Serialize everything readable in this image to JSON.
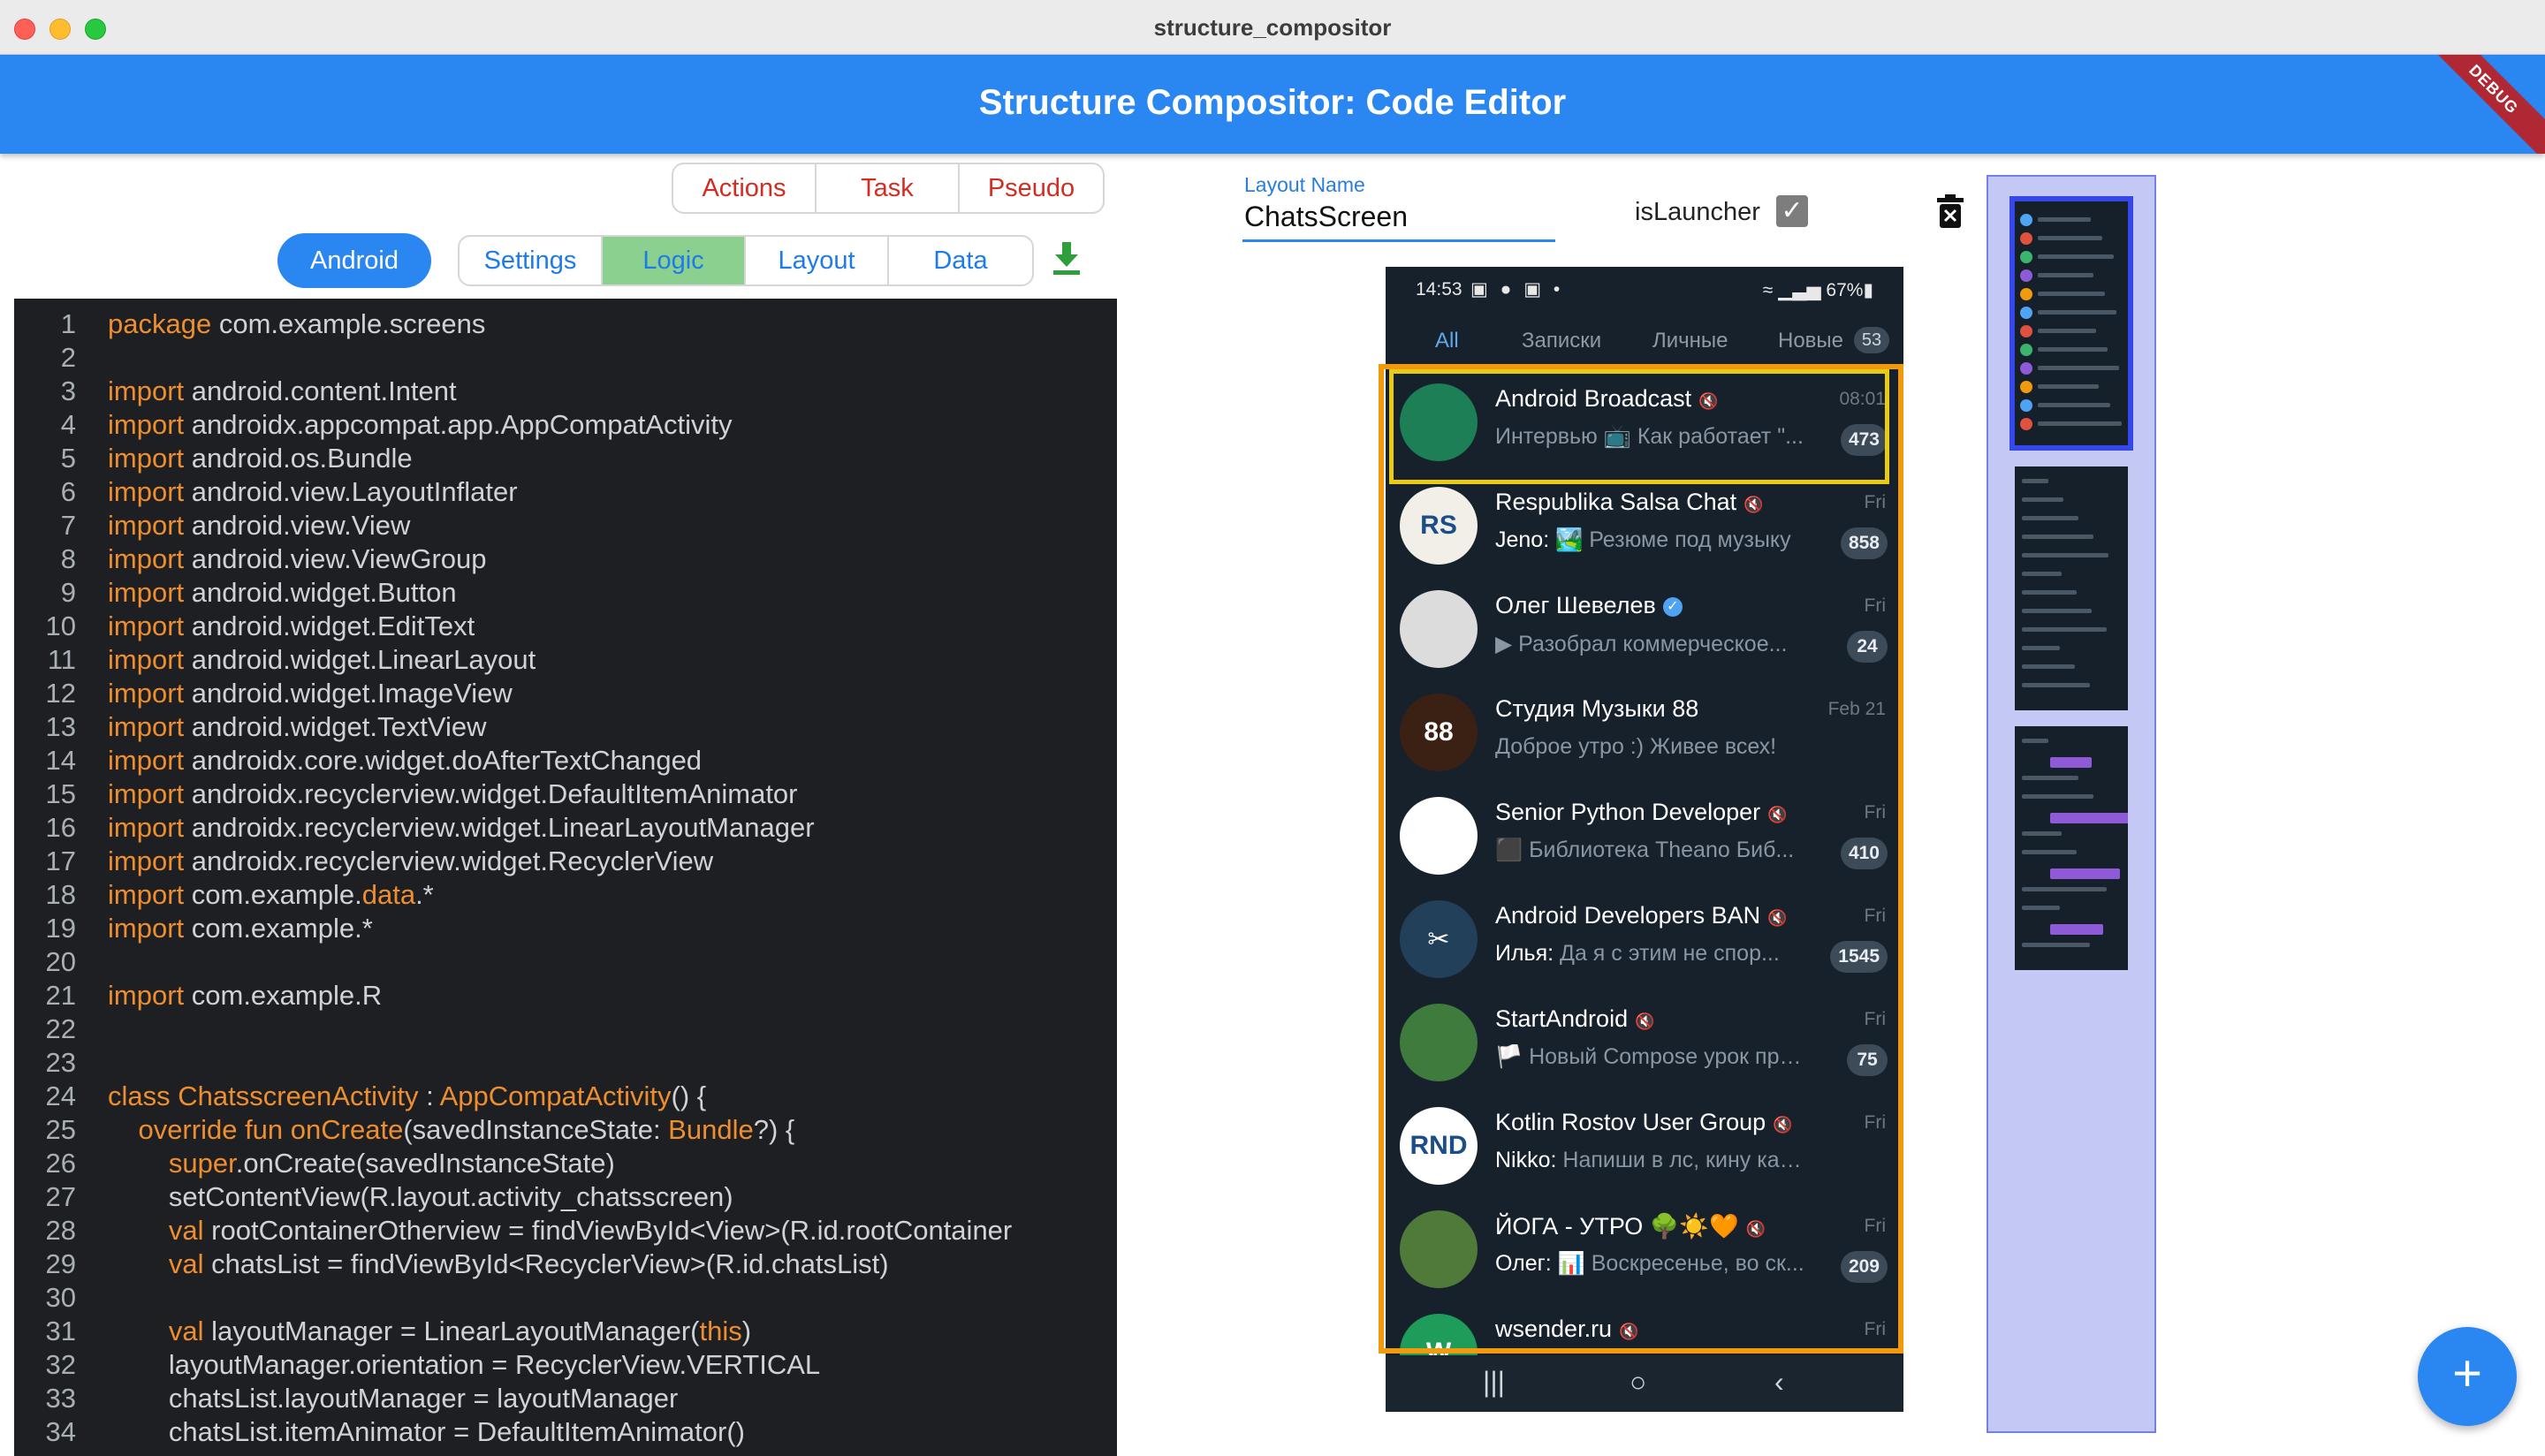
{
  "window": {
    "title": "structure_compositor"
  },
  "appbar": {
    "title": "Structure Compositor: Code Editor",
    "debug_label": "DEBUG"
  },
  "top_tabs": [
    "Actions",
    "Task",
    "Pseudo"
  ],
  "platform_button": "Android",
  "main_tabs": [
    {
      "label": "Settings",
      "active": false
    },
    {
      "label": "Logic",
      "active": true
    },
    {
      "label": "Layout",
      "active": false
    },
    {
      "label": "Data",
      "active": false
    }
  ],
  "code_lines": [
    {
      "n": "1",
      "kw": "package",
      "rest": " com.example.screens"
    },
    {
      "n": "2",
      "kw": "",
      "rest": ""
    },
    {
      "n": "3",
      "kw": "import",
      "rest": " android.content.Intent"
    },
    {
      "n": "4",
      "kw": "import",
      "rest": " androidx.appcompat.app.AppCompatActivity"
    },
    {
      "n": "5",
      "kw": "import",
      "rest": " android.os.Bundle"
    },
    {
      "n": "6",
      "kw": "import",
      "rest": " android.view.LayoutInflater"
    },
    {
      "n": "7",
      "kw": "import",
      "rest": " android.view.View"
    },
    {
      "n": "8",
      "kw": "import",
      "rest": " android.view.ViewGroup"
    },
    {
      "n": "9",
      "kw": "import",
      "rest": " android.widget.Button"
    },
    {
      "n": "10",
      "kw": "import",
      "rest": " android.widget.EditText"
    },
    {
      "n": "11",
      "kw": "import",
      "rest": " android.widget.LinearLayout"
    },
    {
      "n": "12",
      "kw": "import",
      "rest": " android.widget.ImageView"
    },
    {
      "n": "13",
      "kw": "import",
      "rest": " android.widget.TextView"
    },
    {
      "n": "14",
      "kw": "import",
      "rest": " androidx.core.widget.doAfterTextChanged"
    },
    {
      "n": "15",
      "kw": "import",
      "rest": " androidx.recyclerview.widget.DefaultItemAnimator"
    },
    {
      "n": "16",
      "kw": "import",
      "rest": " androidx.recyclerview.widget.LinearLayoutManager"
    },
    {
      "n": "17",
      "kw": "import",
      "rest": " androidx.recyclerview.widget.RecyclerView"
    },
    {
      "n": "18",
      "kw": "import",
      "rest": " com.example.",
      "kw2": "data",
      "rest2": ".*"
    },
    {
      "n": "19",
      "kw": "import",
      "rest": " com.example.*"
    },
    {
      "n": "20",
      "kw": "",
      "rest": ""
    },
    {
      "n": "21",
      "kw": "import",
      "rest": " com.example.R"
    },
    {
      "n": "22",
      "kw": "",
      "rest": ""
    },
    {
      "n": "23",
      "kw": "",
      "rest": ""
    },
    {
      "n": "24",
      "kw": "class",
      "rest": " ",
      "kw2": "ChatsscreenActivity",
      "rest2": " : ",
      "kw3": "AppCompatActivity",
      "rest3": "() {"
    },
    {
      "n": "25",
      "indent": "    ",
      "kw": "override fun",
      "rest": " ",
      "kw2": "onCreate",
      "rest2": "(savedInstanceState: ",
      "kw3": "Bundle",
      "rest3": "?) {"
    },
    {
      "n": "26",
      "indent": "        ",
      "kw": "super",
      "rest": ".onCreate(savedInstanceState)"
    },
    {
      "n": "27",
      "indent": "        ",
      "kw": "",
      "rest": "setContentView(R.layout.activity_chatsscreen)"
    },
    {
      "n": "28",
      "indent": "        ",
      "kw": "val",
      "rest": " rootContainerOtherview = findViewById<View>(R.id.rootContainer"
    },
    {
      "n": "29",
      "indent": "        ",
      "kw": "val",
      "rest": " chatsList = findViewById<RecyclerView>(R.id.chatsList)"
    },
    {
      "n": "30",
      "kw": "",
      "rest": ""
    },
    {
      "n": "31",
      "indent": "        ",
      "kw": "val",
      "rest": " layoutManager = LinearLayoutManager(",
      "kw2": "this",
      "rest2": ")"
    },
    {
      "n": "32",
      "indent": "        ",
      "kw": "",
      "rest": "layoutManager.orientation = RecyclerView.VERTICAL"
    },
    {
      "n": "33",
      "indent": "        ",
      "kw": "",
      "rest": "chatsList.layoutManager = layoutManager"
    },
    {
      "n": "34",
      "indent": "        ",
      "kw": "",
      "rest": "chatsList.itemAnimator = DefaultItemAnimator()"
    }
  ],
  "layout_form": {
    "label": "Layout Name",
    "value": "ChatsScreen",
    "launcher_label": "isLauncher",
    "launcher_checked": true
  },
  "phone": {
    "status_time": "14:53",
    "status_icons": "▣ ● ▣ •",
    "status_right": "≈ ▁▃▅ 67%▮",
    "tabs": [
      "All",
      "Записки",
      "Личные",
      "Новые"
    ],
    "tab_badge": "53",
    "chats": [
      {
        "name": "Android Broadcast",
        "time": "08:01",
        "sender": "",
        "message": "Интервью 📺 Как работает \"...",
        "badge": "473",
        "muted": true,
        "avatar_color": "#1c7f55",
        "avatar_text": ""
      },
      {
        "name": "Respublika Salsa Chat",
        "time": "Fri",
        "sender": "Jeno:",
        "message": " 🏞️ Резюме под музыку",
        "badge": "858",
        "muted": true,
        "avatar_color": "#f2efe9",
        "avatar_text": "RS"
      },
      {
        "name": "Олег Шевелев",
        "time": "Fri",
        "sender": "",
        "message": "▶ Разобрал коммерческое...",
        "badge": "24",
        "muted": false,
        "verified": true,
        "avatar_color": "#dcdcdc",
        "avatar_text": ""
      },
      {
        "name": "Студия Музыки 88",
        "time": "Feb 21",
        "sender": "",
        "message": "Доброе утро :) Живее всех!",
        "badge": "",
        "muted": false,
        "avatar_color": "#3b2014",
        "avatar_text": "88"
      },
      {
        "name": "Senior Python Developer",
        "time": "Fri",
        "sender": "",
        "message": "⬛ Библиотека Theano  Биб...",
        "badge": "410",
        "muted": true,
        "avatar_color": "#ffffff",
        "avatar_text": ""
      },
      {
        "name": "Android Developers BAN",
        "time": "Fri",
        "sender": "Илья:",
        "message": " Да я с этим не спор...",
        "badge": "1545",
        "muted": true,
        "avatar_color": "#23405a",
        "avatar_text": "✂"
      },
      {
        "name": "StartAndroid",
        "time": "Fri",
        "sender": "",
        "message": "🏳️ Новый Compose урок про...",
        "badge": "75",
        "muted": true,
        "avatar_color": "#3f7b3d",
        "avatar_text": ""
      },
      {
        "name": "Kotlin Rostov User Group",
        "time": "Fri",
        "sender": "Nikko:",
        "message": " Напиши в лс, кину канал с...",
        "badge": "",
        "muted": true,
        "avatar_color": "#ffffff",
        "avatar_text": "RND"
      },
      {
        "name": "ЙОГА - УТРО 🌳☀️🧡",
        "time": "Fri",
        "sender": "Олег:",
        "message": " 📊 Воскресенье, во ск...",
        "badge": "209",
        "muted": true,
        "avatar_color": "#4f7a3a",
        "avatar_text": ""
      },
      {
        "name": "wsender.ru",
        "time": "Fri",
        "sender": "",
        "message": "",
        "badge": "",
        "muted": true,
        "avatar_color": "#1e9c5a",
        "avatar_text": "W"
      }
    ],
    "nav_icons": [
      "|||",
      "○",
      "‹"
    ]
  },
  "fab_label": "+"
}
